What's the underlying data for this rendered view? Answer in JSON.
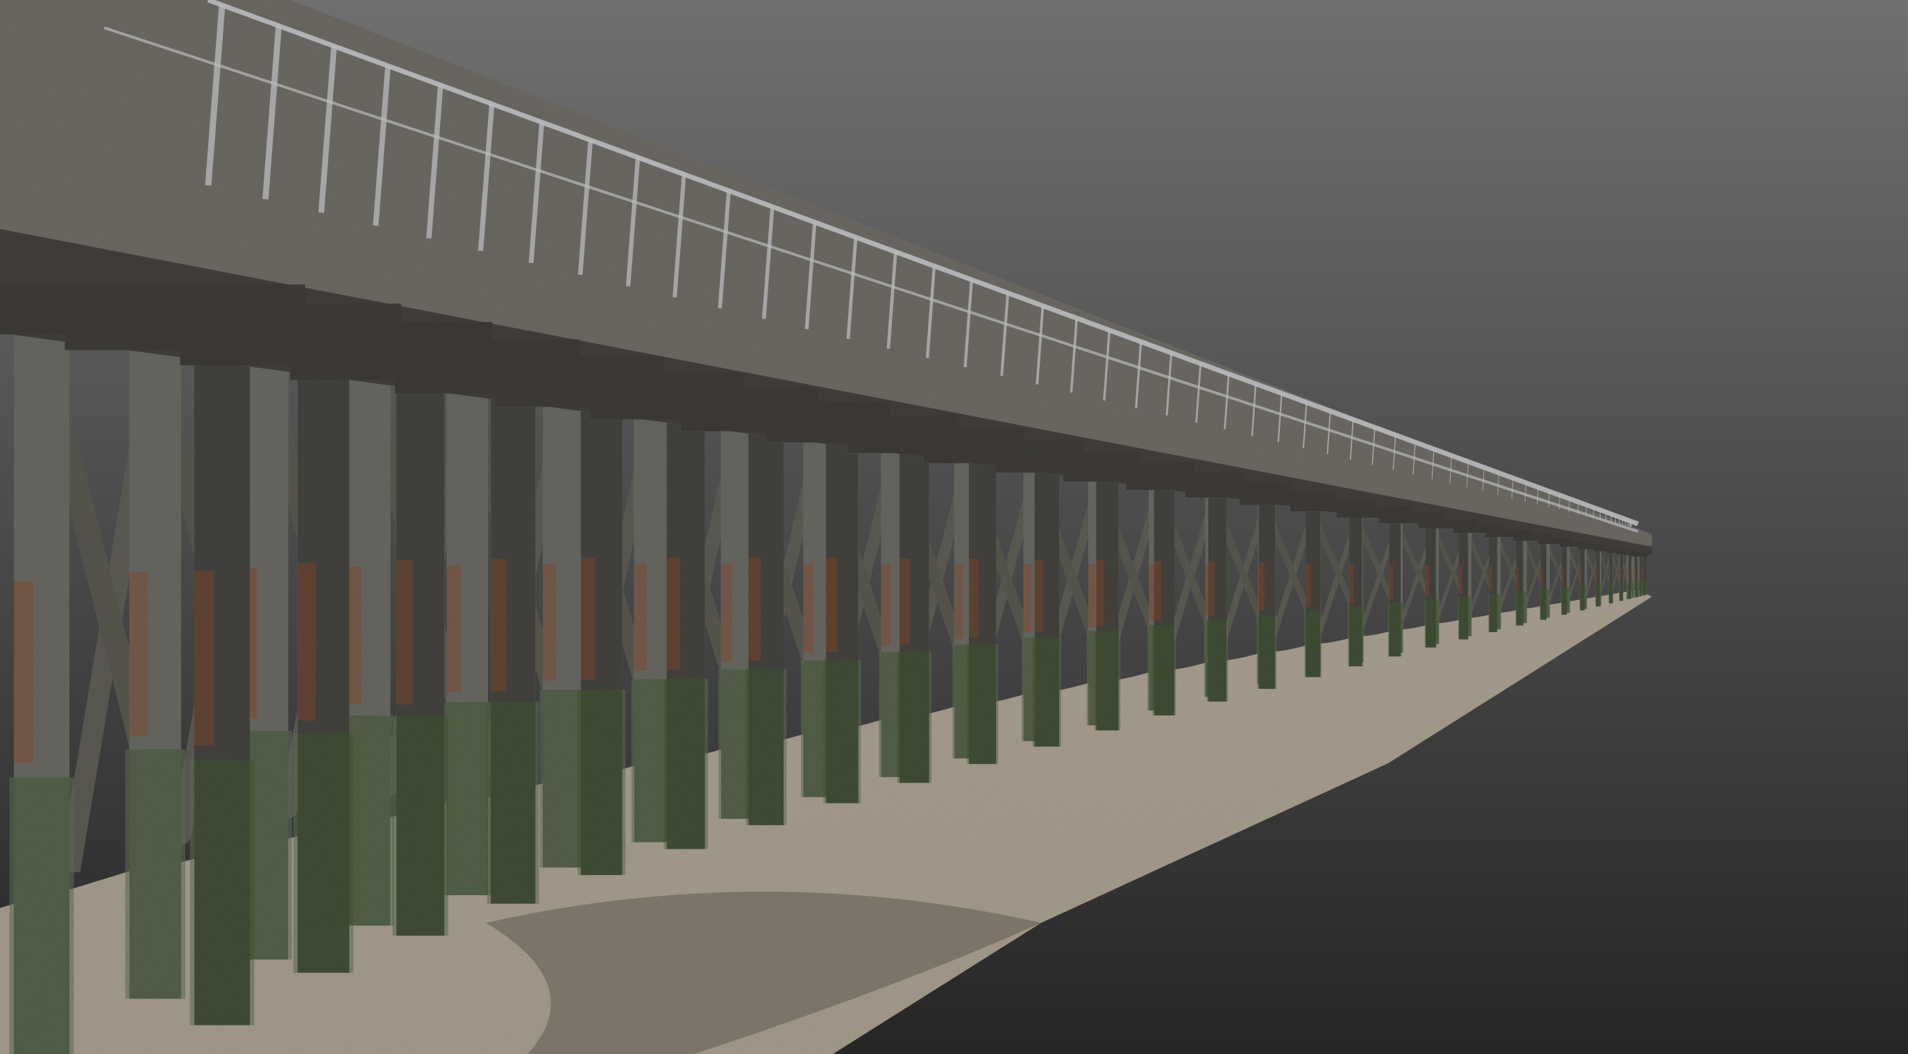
{
  "viewport": {
    "background_top": "#707070",
    "background_bottom": "#262626"
  },
  "scene": {
    "subject": "pier",
    "colors": {
      "deck": "#6f6c66",
      "deck_shadow": "#3e3c38",
      "railing": "#b9bbbd",
      "pile": "#6a6a64",
      "pile_dark": "#45443f",
      "brace": "#5a5950",
      "rust": "#8a4a2a",
      "algae": "#3f5a2e",
      "sand": "#b5aa98",
      "sand_shadow": "#7b7366"
    },
    "icons": [
      "point-cloud-pier"
    ]
  }
}
